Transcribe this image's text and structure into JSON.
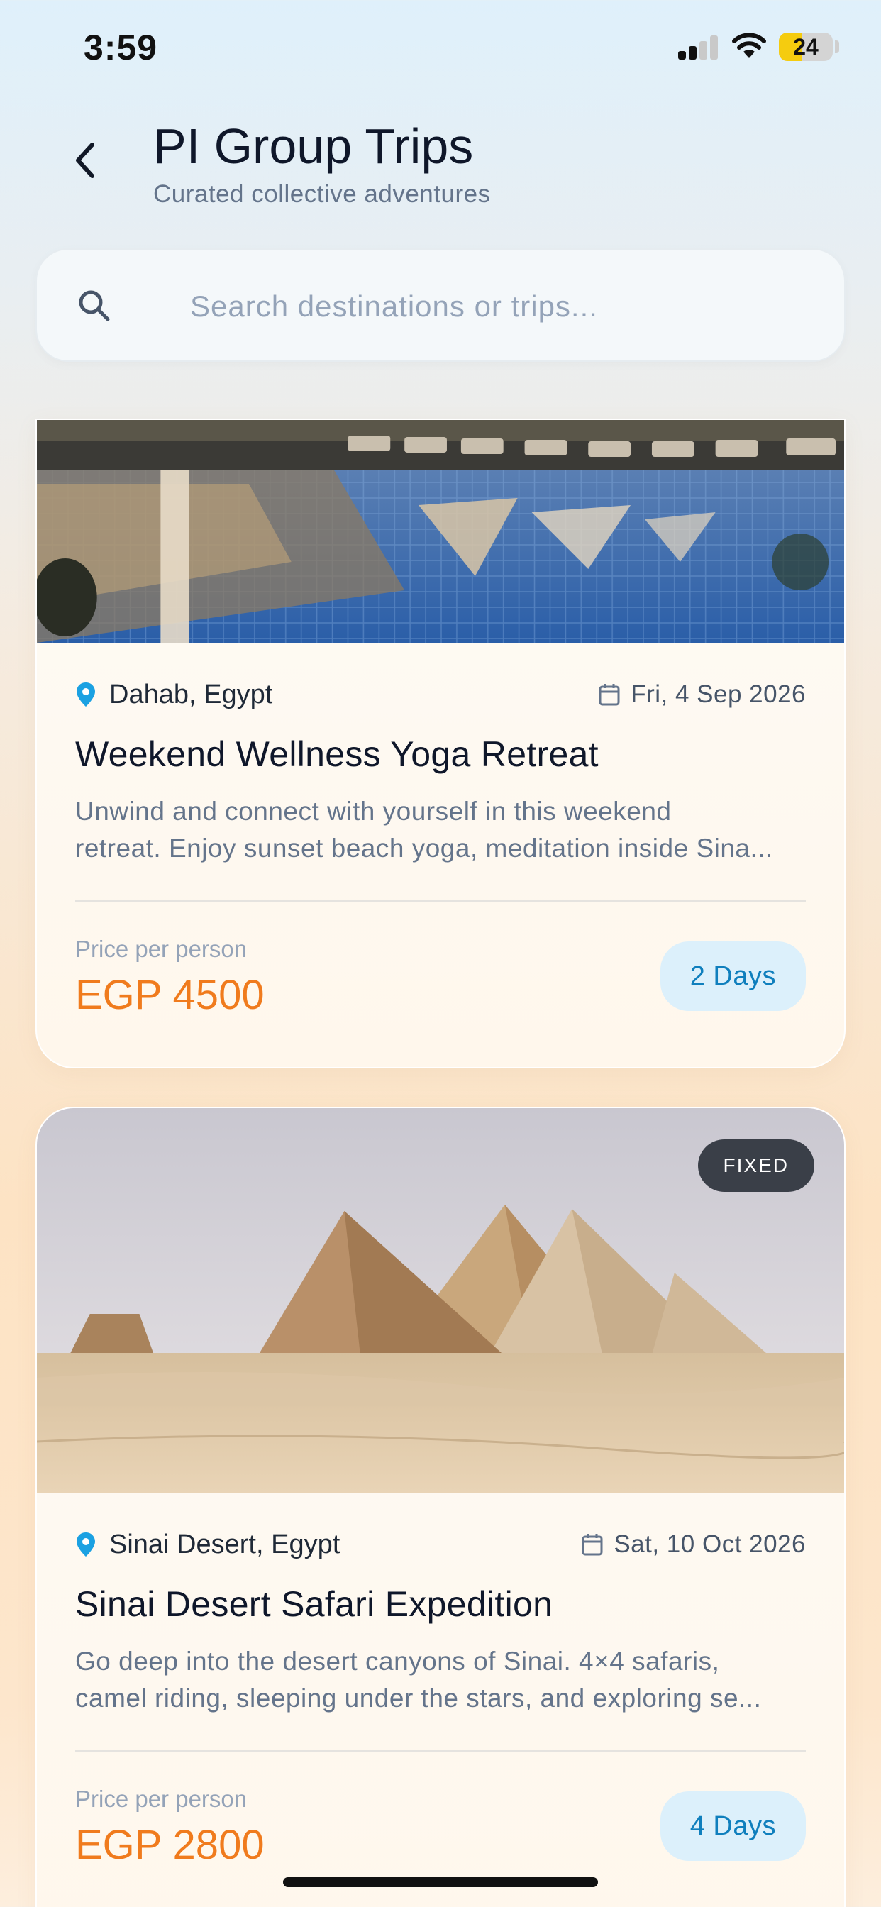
{
  "status_bar": {
    "time": "3:59",
    "battery_level": "24",
    "battery_fraction": 0.24,
    "signal_bars_active": 2,
    "signal_bars_total": 4
  },
  "header": {
    "title": "PI Group Trips",
    "subtitle": "Curated collective adventures",
    "back_icon": "chevron-left-icon"
  },
  "search": {
    "placeholder": "Search destinations or trips...",
    "value": "",
    "icon": "search-icon"
  },
  "trips": [
    {
      "badge": "",
      "location": "Dahab, Egypt",
      "date": "Fri, 4 Sep 2026",
      "title": "Weekend Wellness Yoga Retreat",
      "description": "Unwind and connect with yourself in this weekend\nretreat. Enjoy sunset beach yoga, meditation inside Sina...",
      "price_label": "Price per person",
      "price": "EGP 4500",
      "duration": "2 Days",
      "image": "resort-pool-photo"
    },
    {
      "badge": "FIXED",
      "location": "Sinai Desert, Egypt",
      "date": "Sat, 10 Oct 2026",
      "title": "Sinai Desert Safari Expedition",
      "description": "Go deep into the desert canyons of Sinai. 4×4 safaris,\ncamel riding, sleeping under the stars, and exploring se...",
      "price_label": "Price per person",
      "price": "EGP 2800",
      "duration": "4 Days",
      "image": "pyramids-desert-photo"
    }
  ],
  "colors": {
    "accent_price": "#f07b1d",
    "badge_blue_bg": "#dcf0fb",
    "badge_blue_text": "#0f7fbd",
    "pin_blue": "#1ba1e2"
  }
}
